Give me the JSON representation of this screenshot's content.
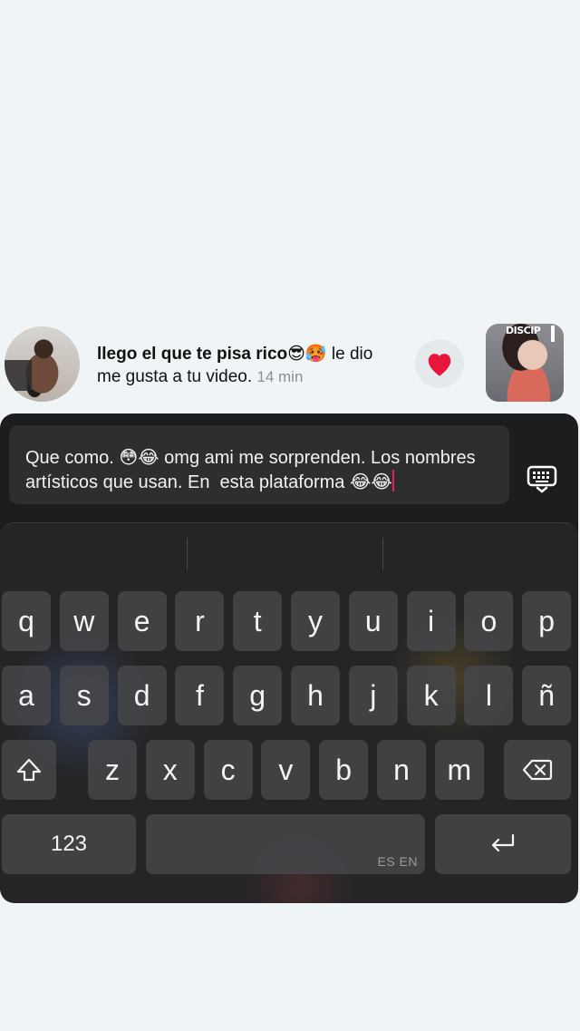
{
  "notification": {
    "user": "llego el que te pisa rico",
    "emojis": "😎🥵",
    "message": " le dio me gusta a tu video.",
    "time": "14 min",
    "thumb_label": "DISCIP"
  },
  "composer": {
    "text": "Que como. 😳😂 omg ami me sorprenden. Los nombres artísticos que usan. En  esta plataforma 😂😂"
  },
  "keyboard": {
    "row1": [
      "q",
      "w",
      "e",
      "r",
      "t",
      "y",
      "u",
      "i",
      "o",
      "p"
    ],
    "row2": [
      "a",
      "s",
      "d",
      "f",
      "g",
      "h",
      "j",
      "k",
      "l",
      "ñ"
    ],
    "row3": [
      "z",
      "x",
      "c",
      "v",
      "b",
      "n",
      "m"
    ],
    "numbers_label": "123",
    "language_indicator": "ES EN",
    "shift_icon": "shift-icon",
    "backspace_icon": "backspace-icon",
    "return_icon": "return-icon"
  },
  "colors": {
    "like": "#e8163a",
    "caret": "#e3245b",
    "panel": "#1d1d1f"
  }
}
